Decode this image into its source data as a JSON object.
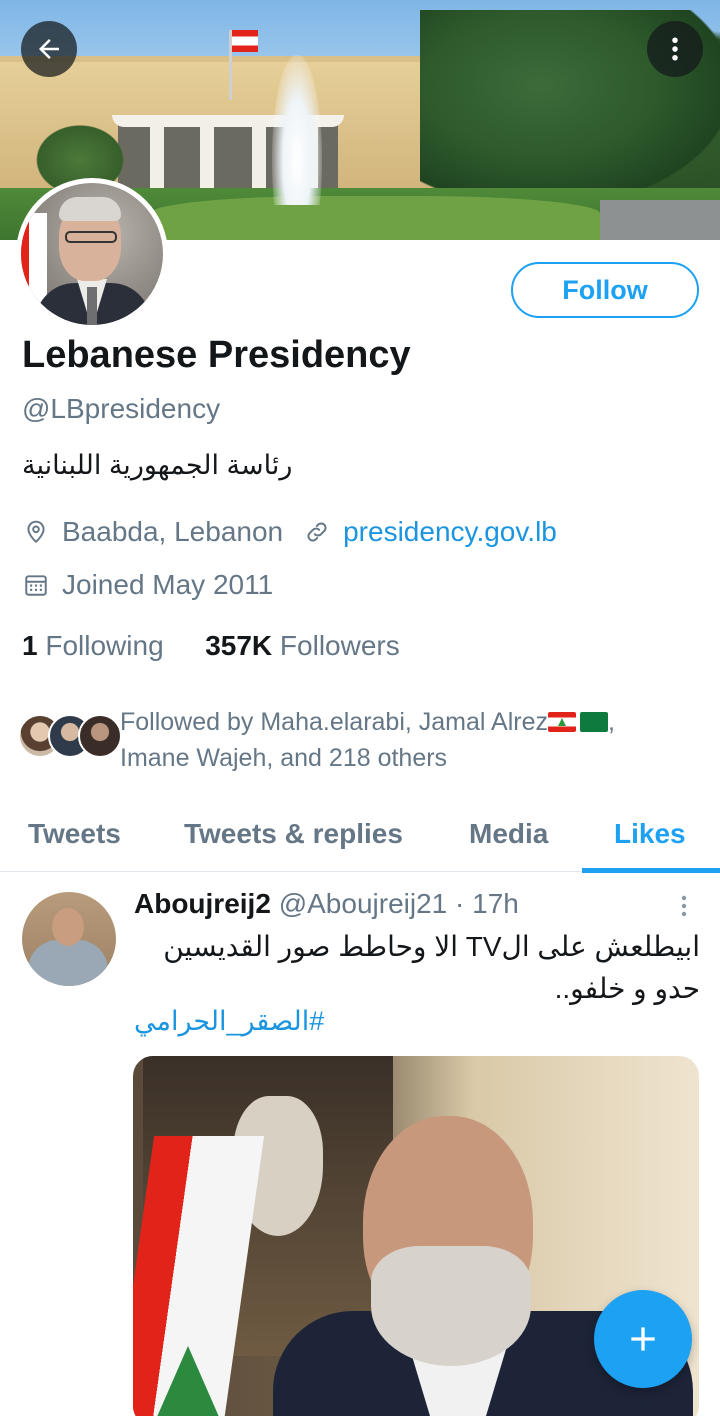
{
  "profile": {
    "name": "Lebanese Presidency",
    "handle": "@LBpresidency",
    "bio": "رئاسة الجمهورية اللبنانية",
    "location": "Baabda, Lebanon",
    "website": "presidency.gov.lb",
    "joined": "Joined May 2011",
    "following_count": "1",
    "following_label": "Following",
    "followers_count": "357K",
    "followers_label": "Followers",
    "follow_button": "Follow"
  },
  "followed_by": {
    "line1": "Followed by Maha.elarabi, Jamal Alrez",
    "line1_suffix": ",",
    "line2": "Imane Wajeh, and 218 others"
  },
  "tabs": [
    {
      "label": "Tweets",
      "active": false
    },
    {
      "label": "Tweets & replies",
      "active": false
    },
    {
      "label": "Media",
      "active": false
    },
    {
      "label": "Likes",
      "active": true
    }
  ],
  "tweet": {
    "display_name": "Aboujreij2",
    "handle": "@Aboujreij21",
    "separator": " · ",
    "time": "17h",
    "text": "ابيطلعش على الTV الا وحاطط صور القديسين حدو و خلفو..",
    "hashtag": "#الصقر_الحرامي"
  },
  "icons": {
    "back": "arrow-left-icon",
    "more": "more-vertical-icon",
    "location": "location-pin-icon",
    "link": "link-icon",
    "calendar": "calendar-icon",
    "compose": "plus-icon"
  },
  "colors": {
    "accent": "#1da1f2",
    "link": "#1b95e0",
    "muted": "#657786",
    "text": "#14171a"
  }
}
